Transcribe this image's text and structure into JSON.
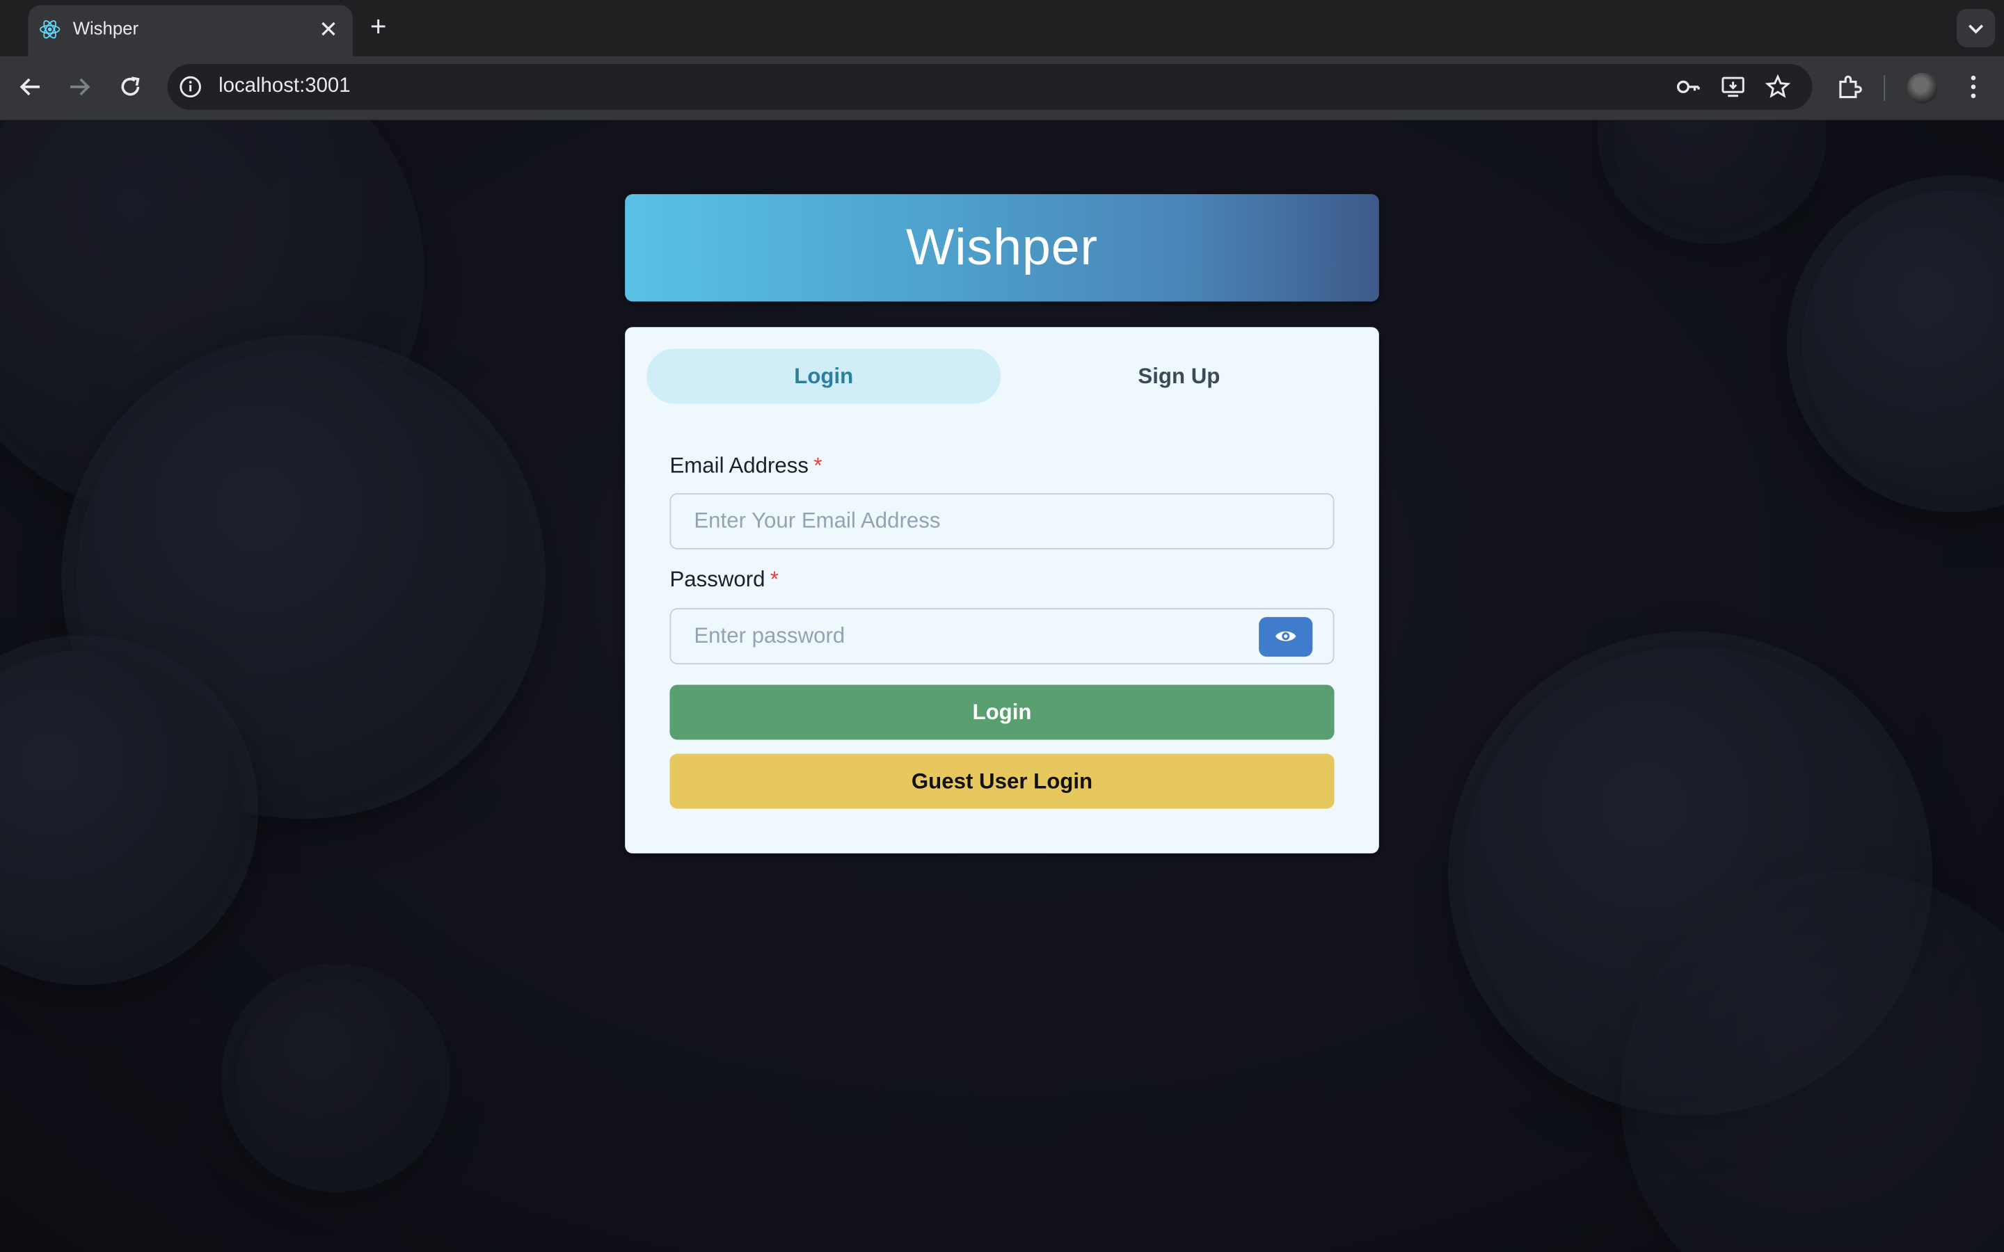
{
  "browser": {
    "tab_title": "Wishper",
    "tab_close_glyph": "✕",
    "new_tab_glyph": "+",
    "url": "localhost:3001",
    "icons": [
      "react-favicon-icon",
      "back-icon",
      "forward-icon",
      "reload-icon",
      "site-info-icon",
      "password-key-icon",
      "install-app-icon",
      "bookmark-star-icon",
      "extensions-icon",
      "profile-avatar",
      "menu-dots-icon",
      "tab-search-icon"
    ]
  },
  "app": {
    "title": "Wishper",
    "tabs": {
      "login": "Login",
      "signup": "Sign Up"
    },
    "form": {
      "email_label": "Email Address",
      "email_placeholder": "Enter Your Email Address",
      "password_label": "Password",
      "password_placeholder": "Enter password",
      "required_marker": "*",
      "login_button": "Login",
      "guest_button": "Guest User Login"
    },
    "colors": {
      "brand_gradient_start": "#5ac1e5",
      "brand_gradient_end": "#3d5a8a",
      "active_tab_bg": "#cfeef7",
      "login_button": "#5a9f6f",
      "guest_button": "#e7c85e",
      "eye_button": "#3f7dcc"
    }
  }
}
